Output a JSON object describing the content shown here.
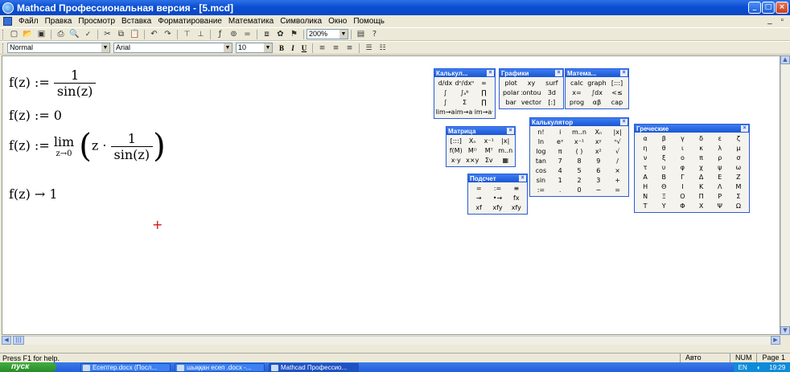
{
  "window": {
    "title": "Mathcad Профессиональная версия - [5.mcd]",
    "controls": [
      "minimize-icon",
      "maximize-icon",
      "close-icon"
    ]
  },
  "menu": {
    "items": [
      "Файл",
      "Правка",
      "Просмотр",
      "Вставка",
      "Форматирование",
      "Математика",
      "Символика",
      "Окно",
      "Помощь"
    ]
  },
  "toolbar": {
    "zoom": "200%",
    "buttons": [
      "new-icon",
      "open-icon",
      "save-icon",
      "print-icon",
      "print-preview-icon",
      "spellcheck-icon",
      "cut-icon",
      "copy-icon",
      "paste-icon",
      "undo-icon",
      "redo-icon",
      "align-icon",
      "align-down-icon",
      "function-icon",
      "insert-unit-icon",
      "calculate-icon",
      "component-icon",
      "resource-icon",
      "help-icon"
    ]
  },
  "format_bar": {
    "style": "Normal",
    "font": "Arial",
    "size": "10",
    "bold": "B",
    "italic": "I",
    "underline": "U"
  },
  "worksheet": {
    "expr1": {
      "lhs": "f(z) := ",
      "num": "1",
      "den": "sin(z)"
    },
    "expr2": "f(z) := 0",
    "expr3": {
      "lhs": "f(z) := ",
      "lim": "lim",
      "sub": "z→0",
      "z": "z · ",
      "num": "1",
      "den": "sin(z)"
    },
    "expr4": "f(z) → 1",
    "cursor": "+"
  },
  "palettes": {
    "calculus": {
      "title": "Калькул...",
      "cells": [
        "d/dx",
        "dⁿ/dxⁿ",
        "∞",
        "∫",
        "∫ₐᵇ",
        "∏",
        "∫",
        "Σ",
        "∏",
        "lim→a",
        "lim→a⁺",
        "lim→a⁻"
      ]
    },
    "graphs": {
      "title": "Графики",
      "cells": [
        "plot",
        "xy",
        "surf",
        "polar",
        "contour",
        "3d",
        "bar",
        "vector",
        "[:]"
      ]
    },
    "math": {
      "title": "Матема...",
      "cells": [
        "calc",
        "graph",
        "[:::]",
        "x=",
        "∫dx",
        "<≤",
        "prog",
        "αβ",
        "cap"
      ]
    },
    "matrix": {
      "title": "Матрица",
      "cells": [
        "[:::]",
        "Xₙ",
        "x⁻¹",
        "|x|",
        "f(M)",
        "M⁽⁾",
        "Mᵀ",
        "m..n",
        "x·y",
        "x×y",
        "Σv",
        "▦"
      ]
    },
    "calculator": {
      "title": "Калькулятор",
      "cells": [
        "n!",
        "i",
        "m..n",
        "Xₙ",
        "|x|",
        "ln",
        "eˣ",
        "x⁻¹",
        "xʸ",
        "ⁿ√",
        "log",
        "π",
        "( )",
        "x²",
        "√",
        "tan",
        "7",
        "8",
        "9",
        "/",
        "cos",
        "4",
        "5",
        "6",
        "×",
        "sin",
        "1",
        "2",
        "3",
        "+",
        ":=",
        ".",
        "0",
        "−",
        "="
      ]
    },
    "evaluation": {
      "title": "Подсчет",
      "cells": [
        "=",
        ":=",
        "≡",
        "→",
        "•→",
        "fx",
        "xf",
        "xfy",
        "xfy"
      ]
    },
    "greek": {
      "title": "Греческие",
      "cells": [
        "α",
        "β",
        "γ",
        "δ",
        "ε",
        "ζ",
        "η",
        "θ",
        "ι",
        "κ",
        "λ",
        "μ",
        "ν",
        "ξ",
        "ο",
        "π",
        "ρ",
        "σ",
        "τ",
        "υ",
        "φ",
        "χ",
        "ψ",
        "ω",
        "Α",
        "Β",
        "Γ",
        "Δ",
        "Ε",
        "Ζ",
        "Η",
        "Θ",
        "Ι",
        "Κ",
        "Λ",
        "Μ",
        "Ν",
        "Ξ",
        "Ο",
        "Π",
        "Ρ",
        "Σ",
        "Τ",
        "Υ",
        "Φ",
        "Χ",
        "Ψ",
        "Ω"
      ]
    }
  },
  "status": {
    "help": "Press F1 for help.",
    "mode": "Авто",
    "num": "NUM",
    "page": "Page 1"
  },
  "taskbar": {
    "start": "пуск",
    "tasks": [
      "Есептер.docx (Посл...",
      "шыққан есеп .docx -...",
      "Mathcad Профессио..."
    ],
    "lang": "EN",
    "clock": "19:29"
  }
}
